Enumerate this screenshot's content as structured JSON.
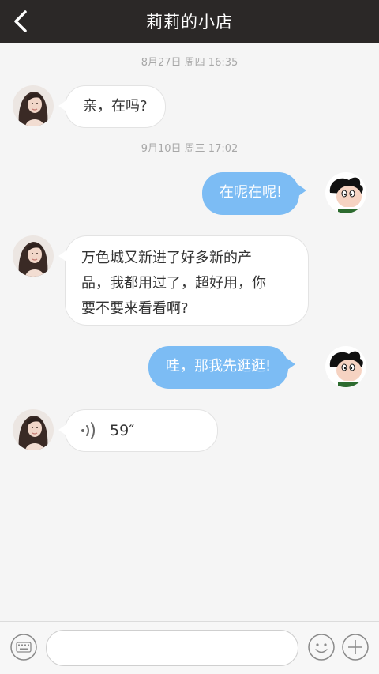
{
  "header": {
    "title": "莉莉的小店",
    "back_icon": "chevron-left-icon"
  },
  "messages": [
    {
      "type": "time",
      "text": "8月27日 周四 16:35"
    },
    {
      "type": "incoming",
      "text": "亲，在吗?"
    },
    {
      "type": "time",
      "text": "9月10日 周三 17:02"
    },
    {
      "type": "outgoing",
      "text": "在呢在呢!"
    },
    {
      "type": "incoming",
      "lines": [
        "万色城又新进了好多新的产",
        "品，我都用过了，超好用，你",
        "要不要来看看啊?"
      ]
    },
    {
      "type": "outgoing",
      "text": "哇，那我先逛逛!"
    },
    {
      "type": "incoming-voice",
      "duration": "59″"
    }
  ],
  "input": {
    "placeholder": ""
  },
  "colors": {
    "header_bg": "#2b2827",
    "outgoing_bubble": "#7cbcf4",
    "incoming_bubble": "#ffffff",
    "background": "#f5f5f5"
  },
  "icons": {
    "keyboard": "keyboard-icon",
    "emoji": "smiley-icon",
    "plus": "plus-icon",
    "voice": "sound-wave-icon"
  }
}
